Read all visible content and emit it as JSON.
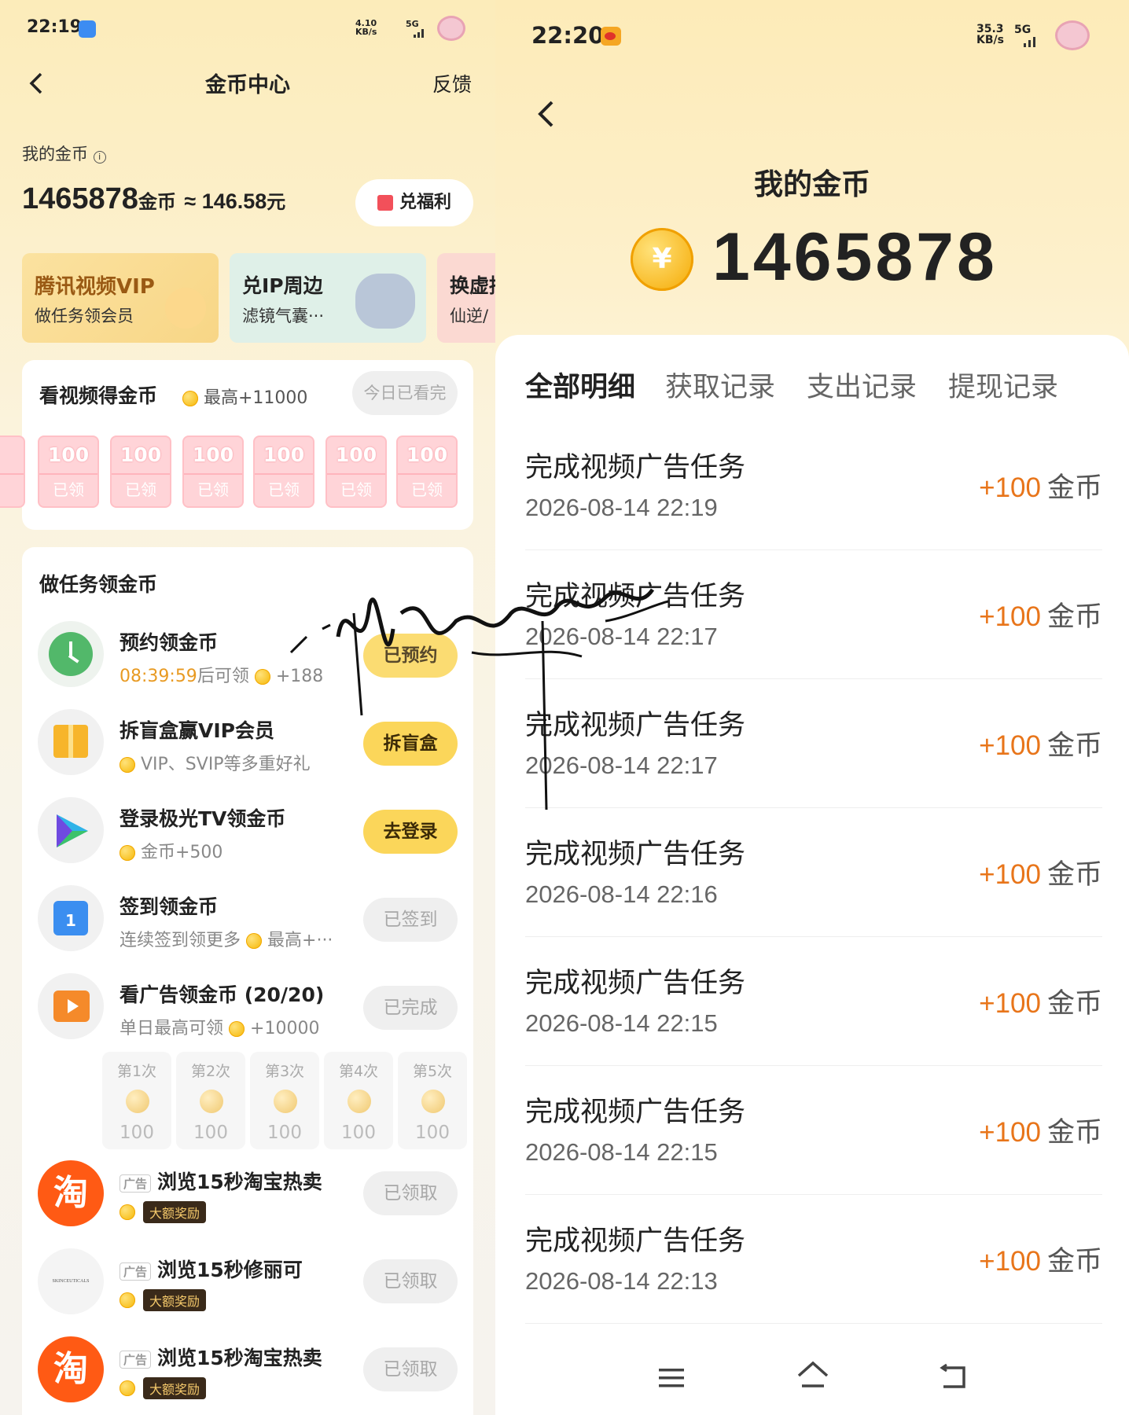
{
  "left": {
    "status": {
      "time": "22:19",
      "net_speed": "4.10",
      "net_unit": "KB/s",
      "net_type": "5G"
    },
    "header": {
      "title": "金币中心",
      "feedback": "反馈"
    },
    "wallet": {
      "label": "我的金币",
      "coins": "1465878",
      "coins_unit": "金币",
      "approx": "≈ 146.58",
      "yuan_unit": "元",
      "exchange_btn": "兑福利"
    },
    "promos": [
      {
        "title": "腾讯视频VIP",
        "sub": "做任务领会员"
      },
      {
        "title": "兑IP周边",
        "sub": "滤镜气囊···"
      },
      {
        "title": "换虚拟",
        "sub": "仙逆/"
      }
    ],
    "watch": {
      "title": "看视频得金币",
      "max": "最高+11000",
      "status_btn": "今日已看完",
      "packets": [
        {
          "amount": "100",
          "state": "已领"
        },
        {
          "amount": "100",
          "state": "已领"
        },
        {
          "amount": "100",
          "state": "已领"
        },
        {
          "amount": "100",
          "state": "已领"
        },
        {
          "amount": "100",
          "state": "已领"
        },
        {
          "amount": "100",
          "state": "已领"
        }
      ]
    },
    "tasks_title": "做任务领金币",
    "tasks": [
      {
        "name": "预约领金币",
        "countdown": "08:39:59",
        "sub": "后可领",
        "reward": "+188",
        "btn": "已预约"
      },
      {
        "name": "拆盲盒赢VIP会员",
        "sub": "VIP、SVIP等多重好礼",
        "btn": "拆盲盒"
      },
      {
        "name": "登录极光TV领金币",
        "sub": "金币+500",
        "btn": "去登录"
      },
      {
        "name": "签到领金币",
        "sub": "连续签到领更多",
        "reward": "最高+···",
        "btn": "已签到"
      },
      {
        "name": "看广告领金币 (20/20)",
        "sub": "单日最高可领",
        "reward": "+10000",
        "btn": "已完成"
      }
    ],
    "ad_counts": [
      {
        "label": "第1次",
        "value": "100"
      },
      {
        "label": "第2次",
        "value": "100"
      },
      {
        "label": "第3次",
        "value": "100"
      },
      {
        "label": "第4次",
        "value": "100"
      },
      {
        "label": "第5次",
        "value": "100"
      }
    ],
    "ads": [
      {
        "tag": "广告",
        "name": "浏览15秒淘宝热卖",
        "badge": "大额奖励",
        "btn": "已领取",
        "logo": "淘"
      },
      {
        "tag": "广告",
        "name": "浏览15秒修丽可",
        "badge": "大额奖励",
        "btn": "已领取",
        "logo": "SKINCEUTICALS"
      },
      {
        "tag": "广告",
        "name": "浏览15秒淘宝热卖",
        "badge": "大额奖励",
        "btn": "已领取",
        "logo": "淘"
      }
    ]
  },
  "right": {
    "status": {
      "time": "22:20",
      "net_speed": "35.3",
      "net_unit": "KB/s",
      "net_type": "5G"
    },
    "title": "我的金币",
    "coins": "1465878",
    "tabs": [
      "全部明细",
      "获取记录",
      "支出记录",
      "提现记录"
    ],
    "records": [
      {
        "title": "完成视频广告任务",
        "time": "2026-08-14 22:19",
        "amount": "+100",
        "unit": "金币"
      },
      {
        "title": "完成视频广告任务",
        "time": "2026-08-14 22:17",
        "amount": "+100",
        "unit": "金币"
      },
      {
        "title": "完成视频广告任务",
        "time": "2026-08-14 22:17",
        "amount": "+100",
        "unit": "金币"
      },
      {
        "title": "完成视频广告任务",
        "time": "2026-08-14 22:16",
        "amount": "+100",
        "unit": "金币"
      },
      {
        "title": "完成视频广告任务",
        "time": "2026-08-14 22:15",
        "amount": "+100",
        "unit": "金币"
      },
      {
        "title": "完成视频广告任务",
        "time": "2026-08-14 22:15",
        "amount": "+100",
        "unit": "金币"
      },
      {
        "title": "完成视频广告任务",
        "time": "2026-08-14 22:13",
        "amount": "+100",
        "unit": "金币"
      }
    ]
  },
  "colors": {
    "accent": "#fbd65a",
    "amount": "#e8751a",
    "coin": "#f5b500"
  }
}
